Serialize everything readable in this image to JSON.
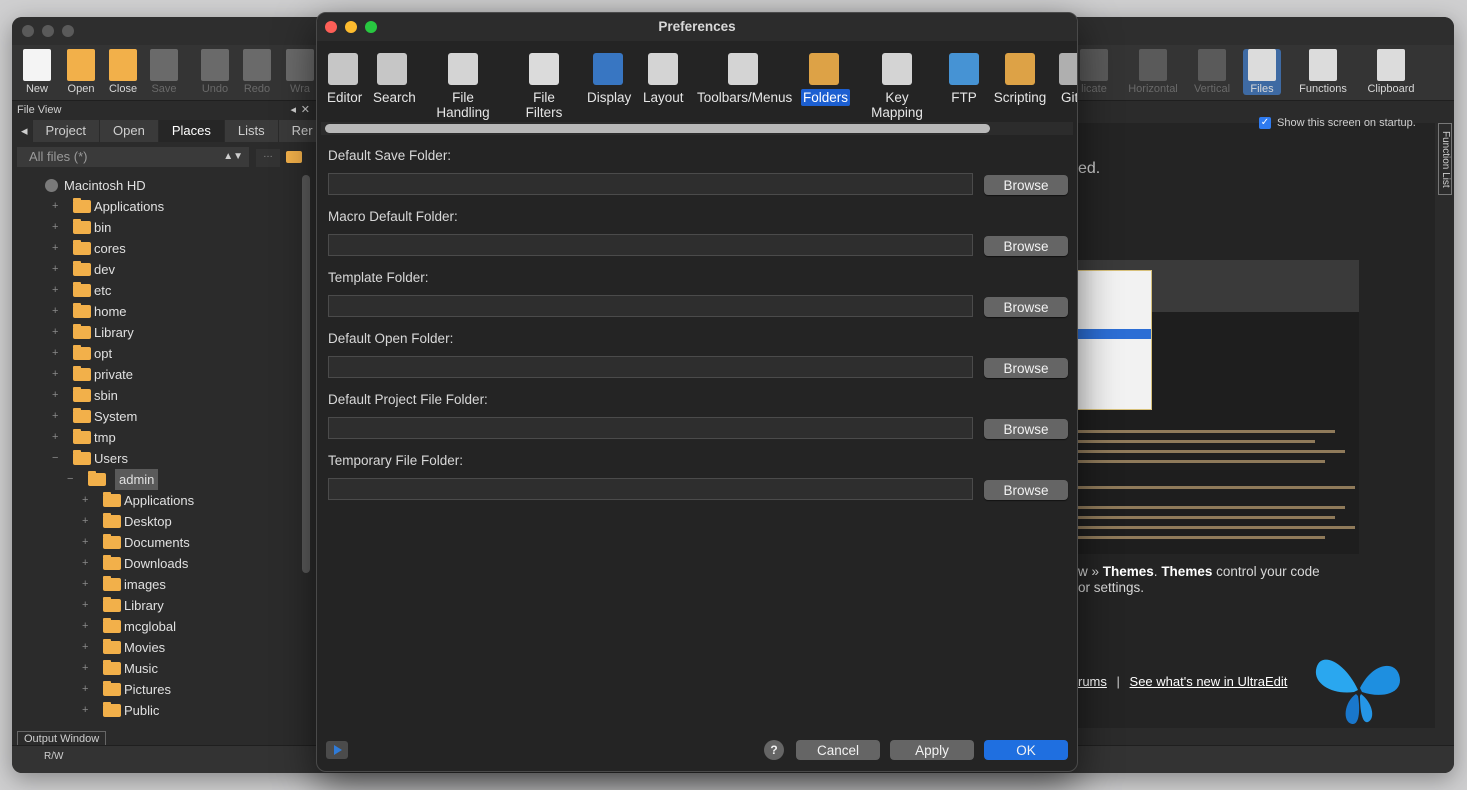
{
  "app": {
    "toolbar_left": [
      {
        "label": "New",
        "icon": "new-file-icon"
      },
      {
        "label": "Open",
        "icon": "open-folder-icon"
      },
      {
        "label": "Close",
        "icon": "close-folder-icon"
      },
      {
        "label": "Save",
        "icon": "save-icon"
      },
      {
        "label": "Undo",
        "icon": "undo-icon"
      },
      {
        "label": "Redo",
        "icon": "redo-icon"
      },
      {
        "label": "Wra",
        "icon": "wrap-icon"
      }
    ],
    "toolbar_right": [
      {
        "label": "licate",
        "icon": "duplicate-icon"
      },
      {
        "label": "Horizontal",
        "icon": "horizontal-split-icon"
      },
      {
        "label": "Vertical",
        "icon": "vertical-split-icon"
      },
      {
        "label": "Files",
        "icon": "files-icon"
      },
      {
        "label": "Functions",
        "icon": "functions-icon"
      },
      {
        "label": "Clipboard",
        "icon": "clipboard-icon"
      }
    ],
    "file_view": {
      "title": "File View",
      "tabs": [
        "Project",
        "Open",
        "Places",
        "Lists",
        "Rer"
      ],
      "active_tab": "Places",
      "filter": "All files (*)",
      "tree": [
        {
          "label": "Macintosh HD",
          "level": 0,
          "disk": true
        },
        {
          "label": "Applications",
          "level": 1
        },
        {
          "label": "bin",
          "level": 1
        },
        {
          "label": "cores",
          "level": 1
        },
        {
          "label": "dev",
          "level": 1
        },
        {
          "label": "etc",
          "level": 1
        },
        {
          "label": "home",
          "level": 1
        },
        {
          "label": "Library",
          "level": 1
        },
        {
          "label": "opt",
          "level": 1
        },
        {
          "label": "private",
          "level": 1
        },
        {
          "label": "sbin",
          "level": 1
        },
        {
          "label": "System",
          "level": 1
        },
        {
          "label": "tmp",
          "level": 1
        },
        {
          "label": "Users",
          "level": 1,
          "open": true
        },
        {
          "label": "admin",
          "level": 2,
          "open": true,
          "selected": true
        },
        {
          "label": "Applications",
          "level": 3
        },
        {
          "label": "Desktop",
          "level": 3
        },
        {
          "label": "Documents",
          "level": 3
        },
        {
          "label": "Downloads",
          "level": 3
        },
        {
          "label": "images",
          "level": 3
        },
        {
          "label": "Library",
          "level": 3
        },
        {
          "label": "mcglobal",
          "level": 3
        },
        {
          "label": "Movies",
          "level": 3
        },
        {
          "label": "Music",
          "level": 3
        },
        {
          "label": "Pictures",
          "level": 3
        },
        {
          "label": "Public",
          "level": 3
        }
      ]
    },
    "output_window": "Output Window",
    "status_rw": "R/W",
    "welcome": {
      "show_on_startup": "Show this screen on startup.",
      "partial_text": "ed.",
      "themes_line1_pre": "w » ",
      "themes_bold1": "Themes",
      "themes_dot": ". ",
      "themes_bold2": "Themes",
      "themes_line1_post": " control your code",
      "themes_line2": "or settings.",
      "link_forums": "rums",
      "link_sep": "|",
      "link_whatsnew": "See what's new in UltraEdit",
      "function_list": "Function List"
    }
  },
  "dialog": {
    "title": "Preferences",
    "categories": [
      {
        "label": "Editor",
        "icon": "editor-tools-icon"
      },
      {
        "label": "Search",
        "icon": "binoculars-icon"
      },
      {
        "label": "File Handling",
        "icon": "file-handling-icon"
      },
      {
        "label": "File Filters",
        "icon": "file-filters-icon"
      },
      {
        "label": "Display",
        "icon": "display-icon"
      },
      {
        "label": "Layout",
        "icon": "layout-icon"
      },
      {
        "label": "Toolbars/Menus",
        "icon": "toolbars-menus-icon"
      },
      {
        "label": "Folders",
        "icon": "folder-icon"
      },
      {
        "label": "Key Mapping",
        "icon": "key-mapping-icon"
      },
      {
        "label": "FTP",
        "icon": "ftp-cloud-icon"
      },
      {
        "label": "Scripting",
        "icon": "scripting-scroll-icon"
      },
      {
        "label": "Git",
        "icon": "git-icon"
      }
    ],
    "active_category": "Folders",
    "fields": [
      {
        "label": "Default Save Folder:",
        "value": "",
        "button": "Browse"
      },
      {
        "label": "Macro Default Folder:",
        "value": "",
        "button": "Browse"
      },
      {
        "label": "Template Folder:",
        "value": "",
        "button": "Browse"
      },
      {
        "label": "Default Open Folder:",
        "value": "",
        "button": "Browse"
      },
      {
        "label": "Default Project File Folder:",
        "value": "",
        "button": "Browse"
      },
      {
        "label": "Temporary File Folder:",
        "value": "",
        "button": "Browse"
      }
    ],
    "footer": {
      "help": "?",
      "cancel": "Cancel",
      "apply": "Apply",
      "ok": "OK"
    }
  },
  "colors": {
    "accent": "#1f6fe0",
    "folder": "#f2b04a",
    "dialog_bg": "#242424"
  }
}
